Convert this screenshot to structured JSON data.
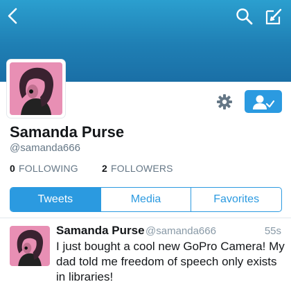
{
  "header": {
    "back_icon": "chevron-left-icon",
    "search_icon": "search-icon",
    "compose_icon": "compose-icon",
    "banner_color": "#1f7fb4"
  },
  "profile": {
    "name": "Samanda Purse",
    "handle": "@samanda666",
    "following_count": "0",
    "following_label": "FOLLOWING",
    "followers_count": "2",
    "followers_label": "FOLLOWERS",
    "settings_icon": "gear-icon",
    "follow_icon": "user-check-icon"
  },
  "tabs": [
    {
      "label": "Tweets",
      "active": true
    },
    {
      "label": "Media",
      "active": false
    },
    {
      "label": "Favorites",
      "active": false
    }
  ],
  "tweet": {
    "name": "Samanda Purse",
    "handle": "@samanda666",
    "time": "55s",
    "text": "I just bought a cool new GoPro Camera! My dad told me freedom of speech only exists in libraries!"
  },
  "colors": {
    "accent": "#2b9ae0",
    "avatar_bg": "#e88fb4"
  }
}
